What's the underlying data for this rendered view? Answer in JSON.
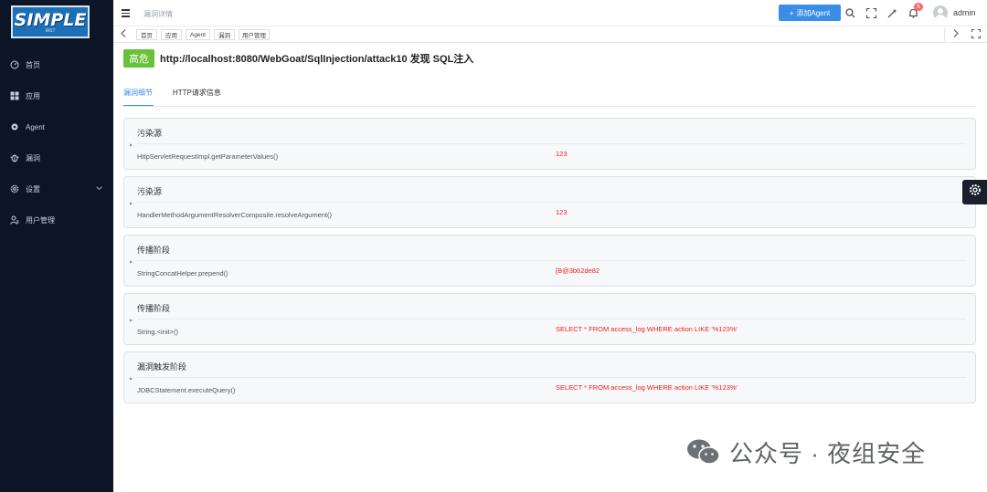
{
  "logo": {
    "text": "SIMPLE",
    "sub": "IAST"
  },
  "sidebar": {
    "items": [
      {
        "label": "首页",
        "icon": "dashboard-icon"
      },
      {
        "label": "应用",
        "icon": "grid-icon"
      },
      {
        "label": "Agent",
        "icon": "agent-icon"
      },
      {
        "label": "漏洞",
        "icon": "bug-icon"
      },
      {
        "label": "设置",
        "icon": "gear-icon",
        "has_submenu": true
      },
      {
        "label": "用户管理",
        "icon": "user-manage-icon"
      }
    ]
  },
  "header": {
    "breadcrumb": "漏洞详情",
    "add_agent_label": "添加Agent",
    "notification_count": "6",
    "username": "admin"
  },
  "tags": [
    "首页",
    "应用",
    "Agent",
    "漏洞",
    "用户管理"
  ],
  "vuln": {
    "severity": "高危",
    "title": "http://localhost:8080/WebGoat/SqlInjection/attack10 发现 SQL注入"
  },
  "tabs": [
    {
      "label": "漏洞细节",
      "active": true
    },
    {
      "label": "HTTP请求信息",
      "active": false
    }
  ],
  "stages": [
    {
      "title": "污染源",
      "method": "HttpServletRequestImpl.getParameterValues()",
      "value": "123"
    },
    {
      "title": "污染源",
      "method": "HandlerMethodArgumentResolverComposite.resolveArgument()",
      "value": "123"
    },
    {
      "title": "传播阶段",
      "method": "StringConcatHelper.prepend()",
      "value": "[B@3b62de82"
    },
    {
      "title": "传播阶段",
      "method": "String.<init>()",
      "value": "SELECT * FROM access_log WHERE action LIKE '%123%'"
    },
    {
      "title": "漏洞触发阶段",
      "method": "JDBCStatement.executeQuery()",
      "value": "SELECT * FROM access_log WHERE action LIKE '%123%'"
    }
  ],
  "watermark": {
    "text": "公众号 · 夜组安全"
  },
  "colors": {
    "sidebar_bg": "#0b1526",
    "accent": "#3a8ee6",
    "severity_high": "#67c23a",
    "value_red": "#f01f1f",
    "badge": "#f56c6c"
  }
}
